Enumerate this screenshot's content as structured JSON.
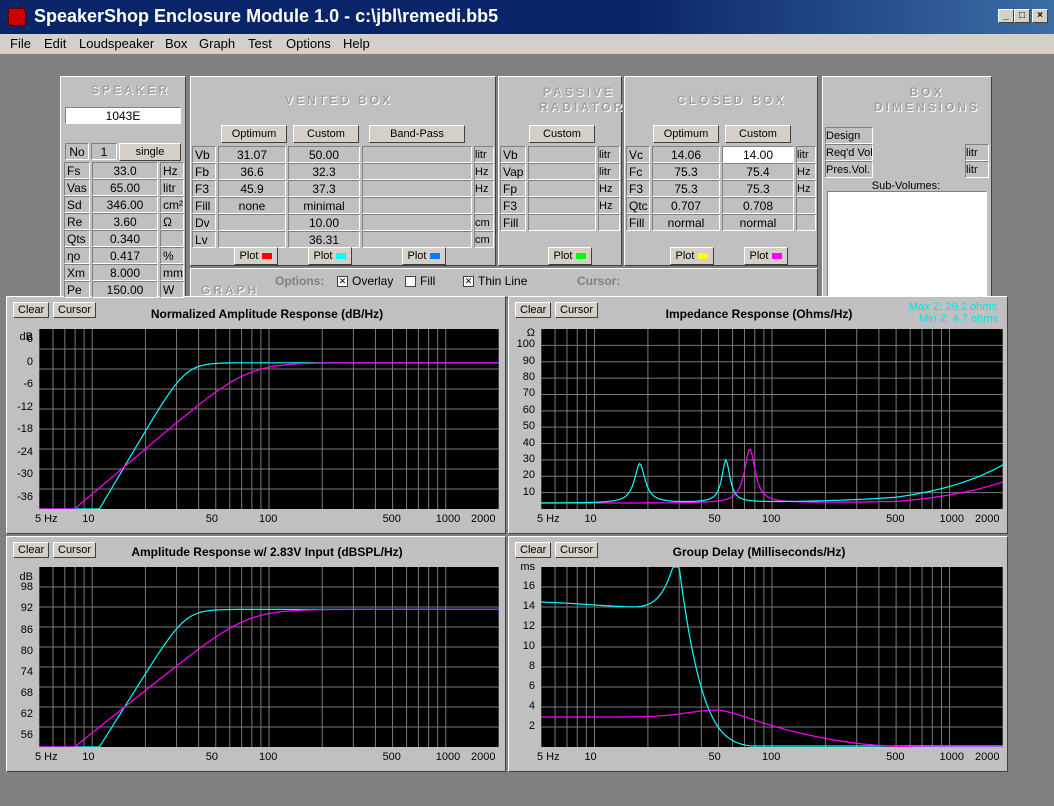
{
  "window": {
    "title": "SpeakerShop Enclosure Module 1.0 - c:\\jbl\\remedi.bb5",
    "min": "_",
    "max": "□",
    "close": "×"
  },
  "menu": [
    "File",
    "Edit",
    "Loudspeaker",
    "Box",
    "Graph",
    "Test",
    "Options",
    "Help"
  ],
  "speaker": {
    "header": "SPEAKER",
    "name": "1043E",
    "no_label": "No",
    "no_value": "1",
    "mode": "single",
    "params": [
      [
        "Fs",
        "33.0",
        "Hz"
      ],
      [
        "Vas",
        "65.00",
        "litr"
      ],
      [
        "Sd",
        "346.00",
        "cm²"
      ],
      [
        "Re",
        "3.60",
        "Ω"
      ],
      [
        "Qts",
        "0.340",
        ""
      ],
      [
        "ηo",
        "0.417",
        "%"
      ],
      [
        "Xm",
        "8.000",
        "mm"
      ],
      [
        "Pe",
        "150.00",
        "W"
      ]
    ]
  },
  "vented": {
    "header": "VENTED BOX",
    "optimum": "Optimum",
    "custom": "Custom",
    "bandpass": "Band-Pass",
    "rows": [
      [
        "Vb",
        "31.07",
        "50.00",
        "litr"
      ],
      [
        "Fb",
        "36.6",
        "32.3",
        "Hz"
      ],
      [
        "F3",
        "45.9",
        "37.3",
        "Hz"
      ],
      [
        "Fill",
        "none",
        "minimal",
        ""
      ],
      [
        "Dv",
        "",
        "10.00",
        "cm"
      ],
      [
        "Lv",
        "",
        "36.31",
        "cm"
      ]
    ],
    "plot": "Plot"
  },
  "passive": {
    "header": "PASSIVE RADIATOR",
    "custom": "Custom",
    "rows": [
      [
        "Vb",
        "litr"
      ],
      [
        "Vap",
        "litr"
      ],
      [
        "Fp",
        "Hz"
      ],
      [
        "F3",
        "Hz"
      ],
      [
        "Fill",
        ""
      ]
    ]
  },
  "closed": {
    "header": "CLOSED BOX",
    "optimum": "Optimum",
    "custom": "Custom",
    "rows": [
      [
        "Vc",
        "14.06",
        "14.00",
        "litr"
      ],
      [
        "Fc",
        "75.3",
        "75.4",
        "Hz"
      ],
      [
        "F3",
        "75.3",
        "75.3",
        "Hz"
      ],
      [
        "Qtc",
        "0.707",
        "0.708",
        ""
      ],
      [
        "Fill",
        "normal",
        "normal",
        ""
      ]
    ]
  },
  "boxdim": {
    "header": "BOX DIMENSIONS",
    "design": "Design",
    "reqd": "Req'd Vol.",
    "pres": "Pres.Vol.",
    "unit": "litr",
    "subvol": "Sub-Volumes:"
  },
  "graphbar": {
    "label": "GRAPH",
    "options": "Options:",
    "overlay": "Overlay",
    "fill": "Fill",
    "thin": "Thin Line",
    "cursor": "Cursor:"
  },
  "colors": {
    "red": "#ff0000",
    "cyan": "#00ffff",
    "blue": "#0080ff",
    "green": "#00ff00",
    "yellow": "#ffff00",
    "magenta": "#ff00ff"
  },
  "graphs": {
    "clear": "Clear",
    "cursor": "Cursor",
    "g1": {
      "title": "Normalized Amplitude Response (dB/Hz)",
      "unit": "dB",
      "yticks": [
        "6",
        "0",
        "-6",
        "-12",
        "-18",
        "-24",
        "-30",
        "-36"
      ]
    },
    "g2": {
      "title": "Impedance Response (Ohms/Hz)",
      "unit": "Ω",
      "maxz": "Max Z: 29.2 ohms",
      "minz": "Min Z: 4.7 ohms",
      "yticks": [
        "100",
        "90",
        "80",
        "70",
        "60",
        "50",
        "40",
        "30",
        "20",
        "10"
      ]
    },
    "g3": {
      "title": "Amplitude Response w/ 2.83V Input (dBSPL/Hz)",
      "unit": "dB",
      "yticks": [
        "98",
        "92",
        "86",
        "80",
        "74",
        "68",
        "62",
        "56"
      ]
    },
    "g4": {
      "title": "Group Delay (Milliseconds/Hz)",
      "unit": "ms",
      "yticks": [
        "16",
        "14",
        "12",
        "10",
        "8",
        "6",
        "4",
        "2"
      ]
    },
    "xticks": [
      "5 Hz",
      "10",
      "50",
      "100",
      "500",
      "1000",
      "2000"
    ]
  }
}
